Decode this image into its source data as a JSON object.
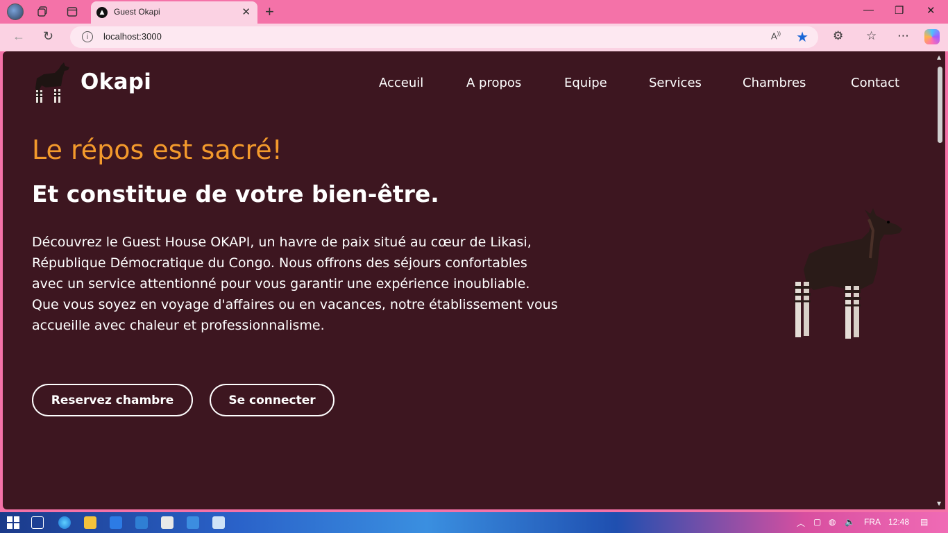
{
  "browser": {
    "tab_title": "Guest Okapi",
    "url": "localhost:3000"
  },
  "site": {
    "brand": "Okapi",
    "nav": [
      "Acceuil",
      "A propos",
      "Equipe",
      "Services",
      "Chambres",
      "Contact"
    ],
    "hero": {
      "accent": "Le répos est sacré!",
      "title": "Et constitue de votre bien-être.",
      "paragraph": "Découvrez le Guest House OKAPI, un havre de paix situé au cœur de Likasi, République Démocratique du Congo. Nous offrons des séjours confortables avec un service attentionné pour vous garantir une expérience inoubliable. Que vous soyez en voyage d'affaires ou en vacances, notre établissement vous accueille avec chaleur et professionnalisme.",
      "primary_button": "Reservez chambre",
      "secondary_button": "Se connecter"
    }
  },
  "taskbar": {
    "language": "FRA",
    "time": "12:48"
  },
  "colors": {
    "page_bg": "#3d1620",
    "accent": "#f39a2c",
    "chrome": "#f472a8"
  }
}
